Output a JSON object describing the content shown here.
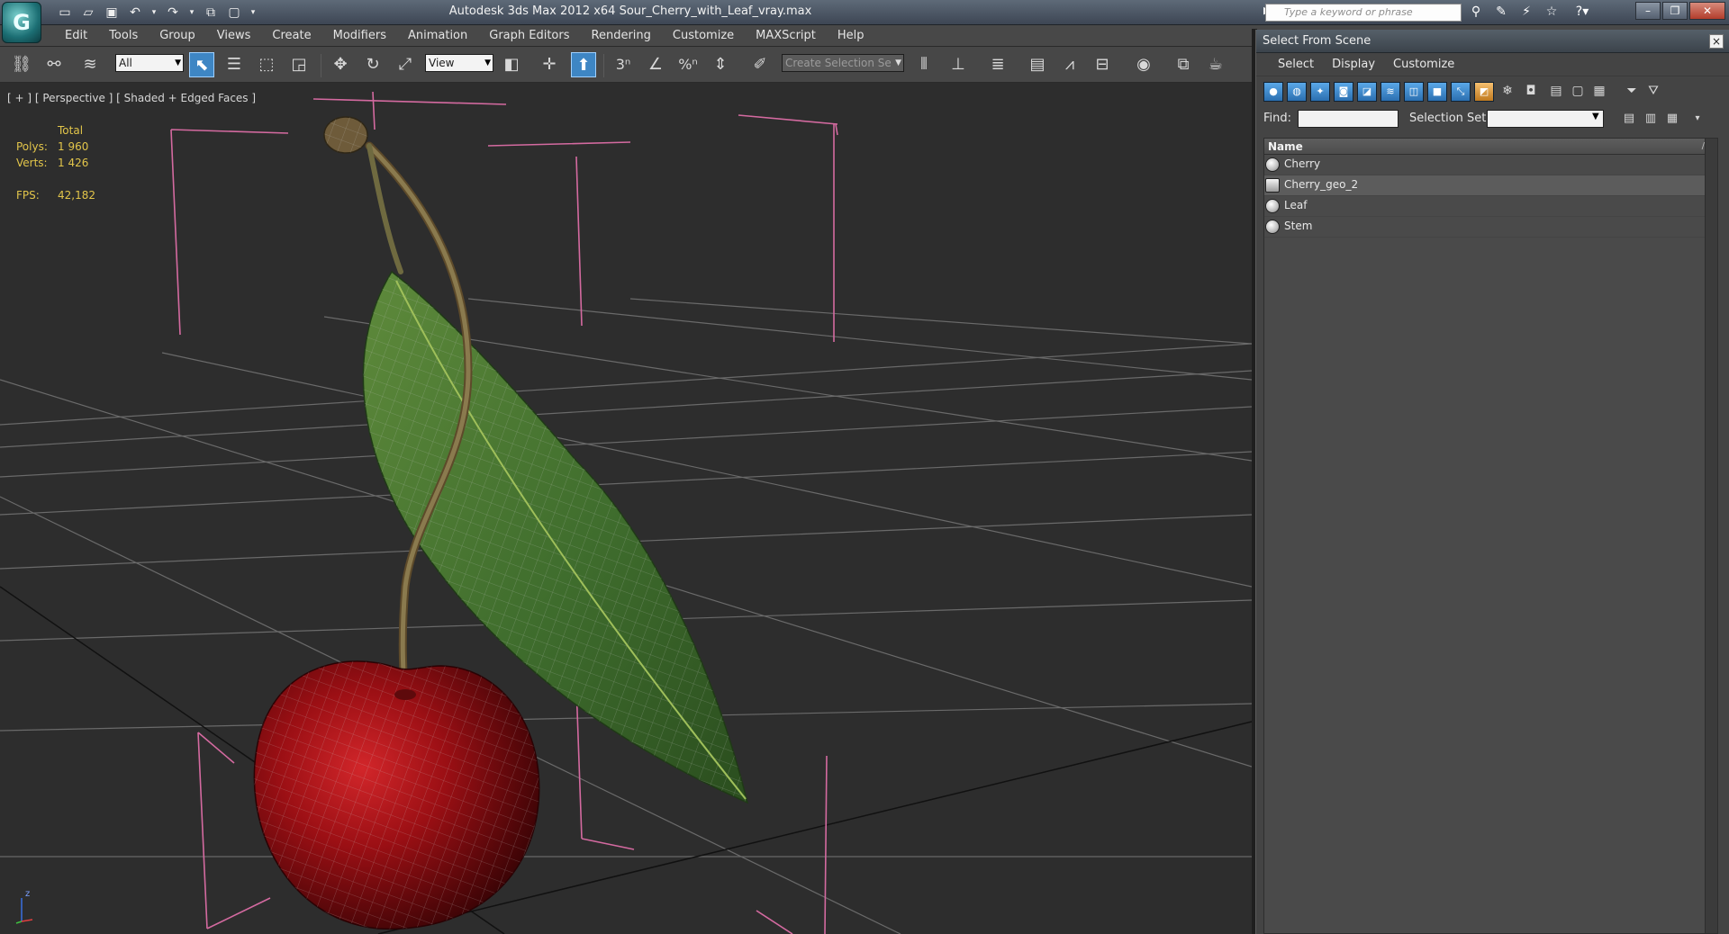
{
  "titlebar": {
    "app_logo": "G",
    "title": "Autodesk 3ds Max  2012 x64      Sour_Cherry_with_Leaf_vray.max",
    "search_placeholder": "Type a keyword or phrase",
    "qat_icons": [
      "new-file-icon",
      "open-file-icon",
      "save-icon",
      "undo-icon",
      "redo-icon",
      "hold-icon",
      "fetch-icon",
      "dropdown-icon"
    ]
  },
  "menubar": {
    "items": [
      "Edit",
      "Tools",
      "Group",
      "Views",
      "Create",
      "Modifiers",
      "Animation",
      "Graph Editors",
      "Rendering",
      "Customize",
      "MAXScript",
      "Help"
    ]
  },
  "toolbar": {
    "selection_filter": "All",
    "ref_coord": "View",
    "named_selection": "Create Selection Se",
    "snap_labels": [
      "3",
      "",
      "%",
      ""
    ]
  },
  "viewport": {
    "label": "[ + ] [ Perspective ] [ Shaded + Edged Faces ]",
    "stats": {
      "total_label": "Total",
      "polys_label": "Polys:",
      "polys_value": "1 960",
      "verts_label": "Verts:",
      "verts_value": "1 426",
      "fps_label": "FPS:",
      "fps_value": "42,182"
    },
    "axis_label": "z"
  },
  "scene_panel": {
    "title": "Select From Scene",
    "close_label": "×",
    "menu": [
      "Select",
      "Display",
      "Customize"
    ],
    "find_label": "Find:",
    "find_value": "",
    "selection_set_label": "Selection Set:",
    "selection_set_value": "",
    "column_header": "Name",
    "objects": [
      {
        "name": "Cherry",
        "selected": false,
        "kind": "geometry"
      },
      {
        "name": "Cherry_geo_2",
        "selected": true,
        "kind": "group"
      },
      {
        "name": "Leaf",
        "selected": false,
        "kind": "geometry"
      },
      {
        "name": "Stem",
        "selected": false,
        "kind": "geometry"
      }
    ]
  },
  "colors": {
    "accent": "#3e86c4",
    "stats_text": "#e2c54a",
    "bbox_lines": "#d46aa0",
    "grid": "#6a6a6a",
    "cherry": "#9b0f14",
    "leaf": "#3f6d2d"
  }
}
